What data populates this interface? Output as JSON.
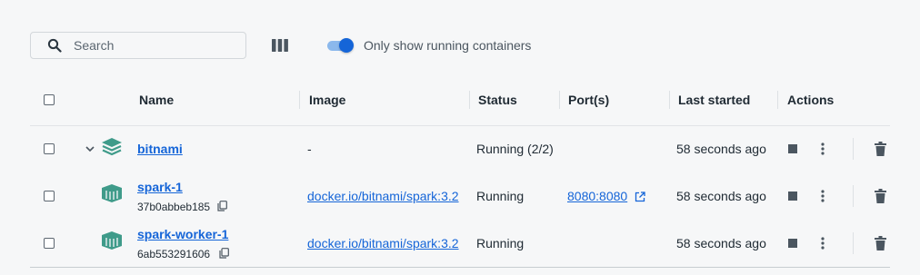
{
  "toolbar": {
    "search_placeholder": "Search",
    "toggle_label": "Only show running containers",
    "toggle_on": true
  },
  "table": {
    "headers": {
      "name": "Name",
      "image": "Image",
      "status": "Status",
      "ports": "Port(s)",
      "last_started": "Last started",
      "actions": "Actions"
    },
    "rows": [
      {
        "name": "bitnami",
        "container_id": "",
        "image": "-",
        "status": "Running (2/2)",
        "ports": "",
        "last_started": "58 seconds ago"
      },
      {
        "name": "spark-1",
        "container_id": "37b0abbeb185",
        "image": "docker.io/bitnami/spark:3.2",
        "status": "Running",
        "ports": "8080:8080",
        "last_started": "58 seconds ago"
      },
      {
        "name": "spark-worker-1",
        "container_id": "6ab553291606",
        "image": "docker.io/bitnami/spark:3.2",
        "status": "Running",
        "ports": "",
        "last_started": "58 seconds ago"
      }
    ]
  },
  "colors": {
    "accent": "#1565d8",
    "container_icon": "#3f9b8a"
  },
  "icons": {
    "search": "search-icon",
    "columns": "columns-icon",
    "stack": "stack-icon",
    "container": "container-icon",
    "copy": "copy-icon",
    "external_link": "external-link-icon",
    "stop": "stop-icon",
    "more": "more-vertical-icon",
    "delete": "trash-icon",
    "expand": "chevron-down-icon"
  }
}
